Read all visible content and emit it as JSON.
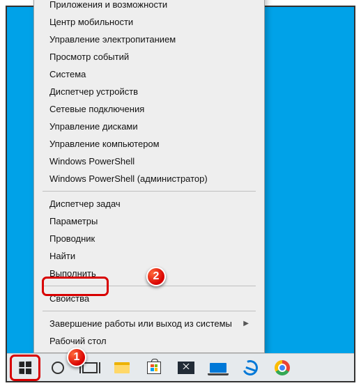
{
  "menu": {
    "group1": [
      "Приложения и возможности",
      "Центр мобильности",
      "Управление электропитанием",
      "Просмотр событий",
      "Система",
      "Диспетчер устройств",
      "Сетевые подключения",
      "Управление дисками",
      "Управление компьютером",
      "Windows PowerShell",
      "Windows PowerShell (администратор)"
    ],
    "group2": [
      "Диспетчер задач",
      "Параметры",
      "Проводник",
      "Найти",
      "Выполнить"
    ],
    "group3_highlighted": "Свойства",
    "group4": [
      {
        "label": "Завершение работы или выход из системы",
        "submenu": true
      },
      {
        "label": "Рабочий стол",
        "submenu": false
      }
    ]
  },
  "badges": {
    "one": "1",
    "two": "2"
  }
}
